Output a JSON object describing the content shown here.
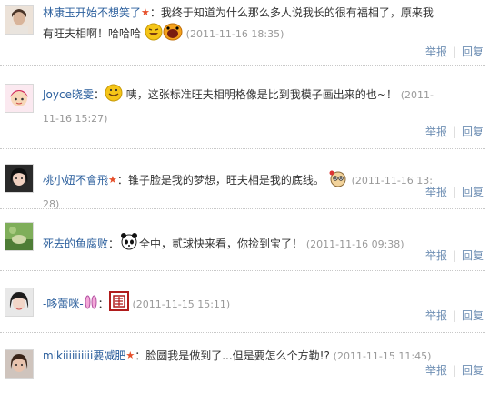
{
  "comments": [
    {
      "user": "林康玉开始不想笑了",
      "text_before": "：我终于知道为什么那么多人说我长的很有福相了，原来我有旺夫相啊！哈哈哈",
      "text_after": "",
      "time": "(2011-11-16 18:35)"
    },
    {
      "user": "Joyce晓雯",
      "text_before": "：",
      "text_after": " 咦，这张标准旺夫相明格像是比到我模子画出来的也~！",
      "time": "(2011-11-16 15:27)"
    },
    {
      "user": "桃小妞不會飛",
      "text_before": "：锥子脸是我的梦想，旺夫相是我的底线。",
      "text_after": "",
      "time": "(2011-11-16 13:28)"
    },
    {
      "user": "死去的鱼腐败",
      "text_before": "：",
      "text_after": "全中，贰球快来看，你捡到宝了！",
      "time": "(2011-11-16 09:38)"
    },
    {
      "user": "-哆蕾咪-",
      "text_before": "：",
      "text_after": "",
      "time": "(2011-11-15 15:11)"
    },
    {
      "user": "mikiiiiiiiiii要减肥",
      "text_before": "：脸圆我是做到了...但是要怎么个方勒!?",
      "text_after": "",
      "time": "(2011-11-15 11:45)"
    }
  ],
  "actions": {
    "report": "举报",
    "separator": "|",
    "reply": "回复"
  },
  "colors": {
    "username": "#2a5e9c",
    "action": "#6f8fb4",
    "time": "#999999",
    "star": "#e64f2a"
  },
  "icons": [
    "star-icon",
    "laugh-emoticon-icon",
    "smile-emoticon-icon",
    "surprised-emoticon-icon",
    "panda-emoticon-icon",
    "bunny-ears-icon",
    "stamp-icon"
  ]
}
